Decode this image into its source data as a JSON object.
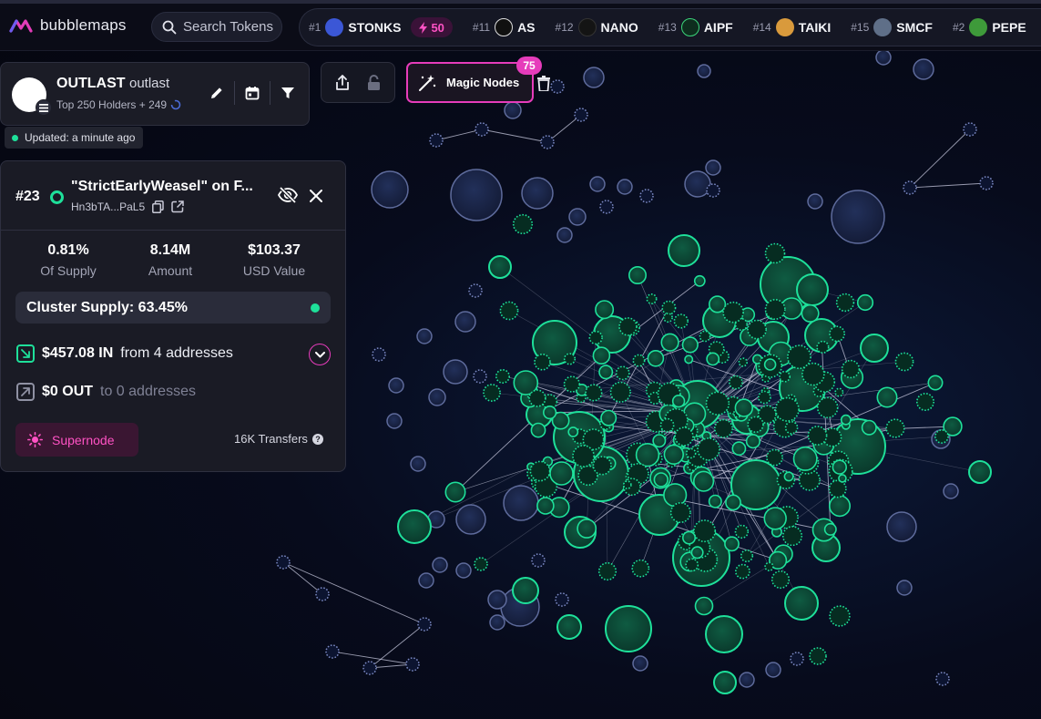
{
  "brand": {
    "name": "bubblemaps"
  },
  "search": {
    "placeholder": "Search Tokens"
  },
  "ticker": [
    {
      "rank": "#1",
      "name": "STONKS",
      "boost": "50",
      "avatar_color": "#3b57d6"
    },
    {
      "rank": "#11",
      "name": "AS",
      "avatar_color": "#101010"
    },
    {
      "rank": "#12",
      "name": "NANO",
      "avatar_color": "#111111"
    },
    {
      "rank": "#13",
      "name": "AIPF",
      "avatar_color": "#0e2d1e"
    },
    {
      "rank": "#14",
      "name": "TAIKI",
      "avatar_color": "#d99a3c"
    },
    {
      "rank": "#15",
      "name": "SMCF",
      "avatar_color": "#5f6f88"
    },
    {
      "rank": "#2",
      "name": "PEPE",
      "avatar_color": "#3e9a3a"
    }
  ],
  "token": {
    "name": "OUTLAST",
    "ticker": "outlast",
    "holders_label": "Top 250 Holders + 249",
    "updated": "Updated: a minute ago"
  },
  "toolbar": {
    "magic_label": "Magic Nodes",
    "magic_count": "75"
  },
  "wallet": {
    "rank": "#23",
    "name": "\"StrictEarlyWeasel\" on F...",
    "address": "Hn3bTA...PaL5",
    "stats": [
      {
        "value": "0.81%",
        "label": "Of Supply"
      },
      {
        "value": "8.14M",
        "label": "Amount"
      },
      {
        "value": "$103.37",
        "label": "USD Value"
      }
    ],
    "cluster_supply": "Cluster Supply: 63.45%",
    "in_amount": "$457.08 IN",
    "in_desc": "from 4 addresses",
    "out_amount": "$0 OUT",
    "out_desc": "to 0 addresses",
    "supernode_label": "Supernode",
    "transfers": "16K Transfers"
  },
  "colors": {
    "accent_pink": "#e63cbb",
    "node_green": "#1ee09a",
    "node_blue": "#1e2a4e",
    "background": "#05060f"
  }
}
